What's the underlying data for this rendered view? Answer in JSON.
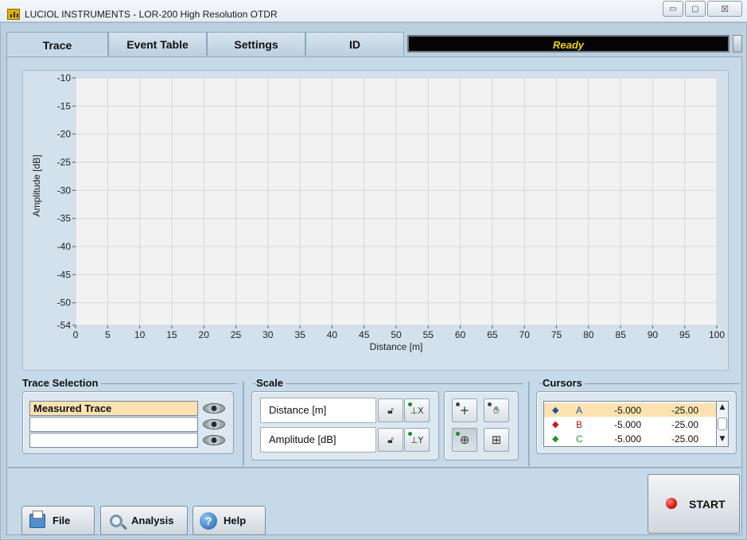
{
  "window": {
    "title": "LUCIOL INSTRUMENTS - LOR-200 High Resolution OTDR",
    "controls": {
      "minimize": "▭",
      "maximize": "▢",
      "close": "☒"
    }
  },
  "tabs": [
    {
      "label": "Trace",
      "active": true
    },
    {
      "label": "Event Table",
      "active": false
    },
    {
      "label": "Settings",
      "active": false
    },
    {
      "label": "ID",
      "active": false
    }
  ],
  "status": {
    "text": "Ready",
    "color": "#f2d200"
  },
  "chart_data": {
    "type": "line",
    "xlabel": "Distance [m]",
    "ylabel": "Amplitude [dB]",
    "xlim": [
      0,
      100
    ],
    "ylim": [
      -54,
      -10
    ],
    "x_ticks": [
      0,
      5,
      10,
      15,
      20,
      25,
      30,
      35,
      40,
      45,
      50,
      55,
      60,
      65,
      70,
      75,
      80,
      85,
      90,
      95,
      100
    ],
    "y_ticks": [
      -10,
      -15,
      -20,
      -25,
      -30,
      -35,
      -40,
      -45,
      -50,
      -54
    ],
    "grid": true,
    "series": []
  },
  "trace_selection": {
    "title": "Trace Selection",
    "rows": [
      {
        "label": "Measured Trace",
        "selected": true
      },
      {
        "label": "",
        "selected": false
      },
      {
        "label": "",
        "selected": false
      }
    ]
  },
  "scale": {
    "title": "Scale",
    "distance_field": "Distance [m]",
    "amplitude_field": "Amplitude [dB]",
    "lock_icon": "lock-icon",
    "autoscale_x_icon": "autoscale-x-icon",
    "autoscale_y_icon": "autoscale-y-icon",
    "tools": [
      "crosshair-icon",
      "pan-hand-icon",
      "zoom-icon",
      "zoom-rect-icon"
    ]
  },
  "cursors": {
    "title": "Cursors",
    "rows": [
      {
        "name": "A",
        "color": "#1d4fb0",
        "x": "-5.000",
        "y": "-25.00",
        "highlight": true
      },
      {
        "name": "B",
        "color": "#c81414",
        "x": "-5.000",
        "y": "-25.00",
        "highlight": false
      },
      {
        "name": "C",
        "color": "#1a9a2a",
        "x": "-5.000",
        "y": "-25.00",
        "highlight": false
      }
    ]
  },
  "bottom": {
    "file": "File",
    "analysis": "Analysis",
    "help": "Help",
    "start": "START"
  }
}
